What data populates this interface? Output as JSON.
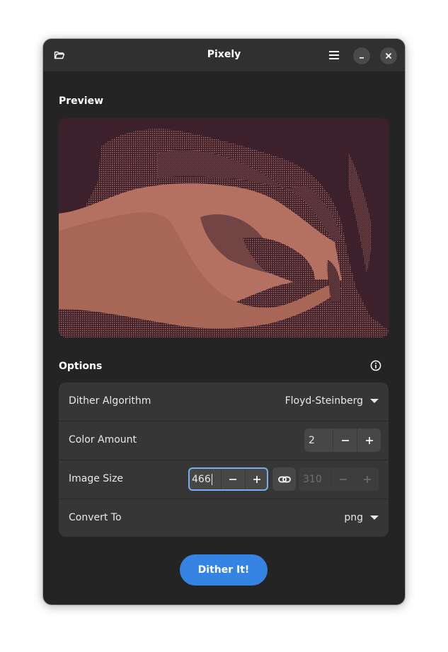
{
  "window": {
    "title": "Pixely"
  },
  "header": {
    "open_icon": "folder-open-icon",
    "menu_icon": "hamburger-menu-icon",
    "minimize_icon": "minimize-icon",
    "close_icon": "close-icon"
  },
  "preview": {
    "label": "Preview",
    "colors": {
      "background": "#3c202b",
      "foreground": "#b47060"
    }
  },
  "options": {
    "label": "Options",
    "info_icon": "info-icon",
    "rows": [
      {
        "label": "Dither Algorithm",
        "value": "Floyd-Steinberg"
      },
      {
        "label": "Color Amount",
        "value": "2"
      },
      {
        "label": "Image Size",
        "width": "466",
        "height": "310"
      },
      {
        "label": "Convert To",
        "value": "png"
      }
    ]
  },
  "actions": {
    "dither_label": "Dither It!"
  },
  "colors": {
    "accent": "#3584e4",
    "focus": "#78aeed"
  }
}
